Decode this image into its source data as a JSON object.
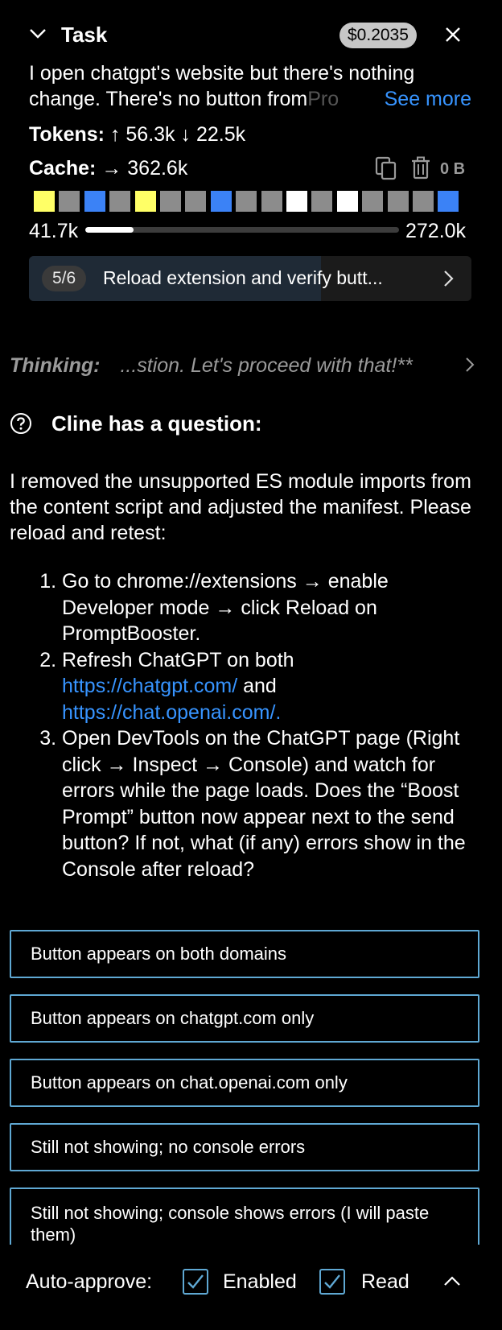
{
  "header": {
    "title": "Task",
    "cost": "$0.2035",
    "description_visible": "I open chatgpt's website but there's nothing change. There's no button from",
    "description_faded": "Pro",
    "see_more": "See more",
    "tokens_label": "Tokens:",
    "tokens_up": "↑ 56.3k",
    "tokens_down": "↓ 22.5k",
    "cache_label": "Cache:",
    "cache_value": "→ 362.6k",
    "storage_size": "0 B",
    "cache_blocks": [
      "#ffff66",
      "#8c8c8c",
      "#3b82f6",
      "#8c8c8c",
      "#ffff66",
      "#8c8c8c",
      "#8c8c8c",
      "#3b82f6",
      "#8c8c8c",
      "#8c8c8c",
      "#ffffff",
      "#8c8c8c",
      "#ffffff",
      "#8c8c8c",
      "#8c8c8c",
      "#8c8c8c",
      "#3b82f6"
    ],
    "context_used": "41.7k",
    "context_max": "272.0k",
    "context_fraction": 0.153
  },
  "current_step": {
    "badge": "5/6",
    "text": "Reload extension and verify butt...",
    "progress_fraction": 0.66
  },
  "thinking": {
    "label": "Thinking:",
    "text": "...stion. Let's proceed with that!**"
  },
  "question": {
    "title": "Cline has a question:",
    "intro": "I removed the unsupported ES module imports from the content script and adjusted the manifest. Please reload and retest:",
    "step1": "Go to chrome://extensions → enable Developer mode → click Reload on PromptBooster.",
    "step2_prefix": "Refresh ChatGPT on both ",
    "step2_link1": "https://chatgpt.com/",
    "step2_mid": " and ",
    "step2_link2": "https://chat.openai.com/.",
    "step3": "Open DevTools on the ChatGPT page (Right click → Inspect → Console) and watch for errors while the page loads. Does the “Boost Prompt” button now appear next to the send button? If not, what (if any) errors show in the Console after reload?"
  },
  "options": [
    "Button appears on both domains",
    "Button appears on chatgpt.com only",
    "Button appears on chat.openai.com only",
    "Still not showing; no console errors",
    "Still not showing; console shows errors (I will paste them)"
  ],
  "auto_approve": {
    "label": "Auto-approve:",
    "enabled_label": "Enabled",
    "read_label": "Read"
  }
}
